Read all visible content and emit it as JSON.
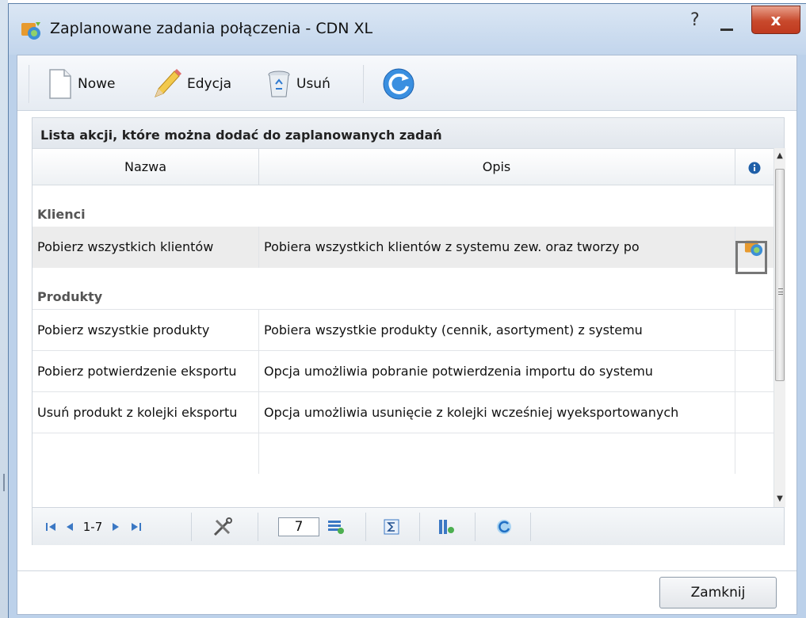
{
  "window": {
    "title": "Zaplanowane zadania połączenia - CDN XL",
    "help": "?",
    "close": "x"
  },
  "toolbar": {
    "new_label": "Nowe",
    "edit_label": "Edycja",
    "delete_label": "Usuń"
  },
  "panel": {
    "header": "Lista akcji, które można dodać do zaplanowanych zadań",
    "columns": [
      "Nazwa",
      "Opis"
    ],
    "groups": [
      {
        "name": "Klienci",
        "rows": [
          {
            "name": "Pobierz wszystkich klientów",
            "desc": "Pobiera wszystkich klientów z systemu zew. oraz tworzy po"
          }
        ]
      },
      {
        "name": "Produkty",
        "rows": [
          {
            "name": "Pobierz wszystkie produkty",
            "desc": "Pobiera wszystkie produkty (cennik, asortyment) z systemu"
          },
          {
            "name": "Pobierz potwierdzenie eksportu",
            "desc": "Opcja umożliwia pobranie potwierdzenia importu do systemu"
          },
          {
            "name": "Usuń produkt z kolejki eksportu",
            "desc": "Opcja umożliwia usunięcie z kolejki wcześniej wyeksportowanych"
          }
        ]
      }
    ]
  },
  "pager": {
    "range": "1-7",
    "page_size": "7"
  },
  "footer": {
    "close_label": "Zamknij"
  },
  "colors": {
    "accent": "#c8492c",
    "group_text": "#555555"
  }
}
